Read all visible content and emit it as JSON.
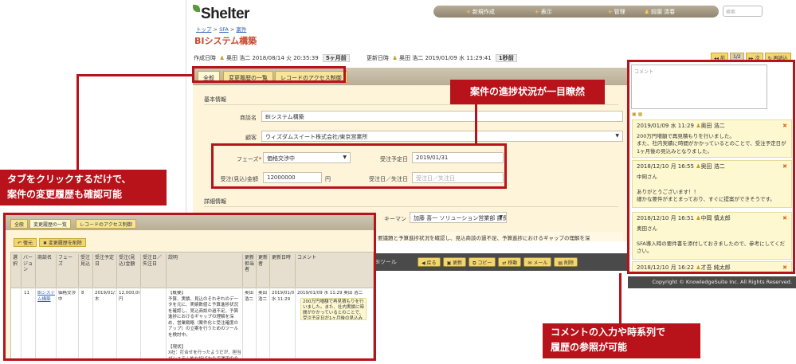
{
  "app": {
    "logo": "Shelter"
  },
  "nav": {
    "new": "新規作成",
    "view": "表示",
    "admin": "管理",
    "user": "前園 清春",
    "search_placeholder": "検索"
  },
  "breadcrumb": {
    "top": "トップ",
    "sfa": "SFA",
    "deal": "案件"
  },
  "page": {
    "title": "BIシステム構築"
  },
  "meta": {
    "created_label": "作成日時",
    "created_user": "奥田 浩二",
    "created_at": "2018/08/14 火 20:35:39",
    "created_ago": "5ヶ月前",
    "updated_label": "更新日時",
    "updated_user": "奥田 浩二",
    "updated_at": "2019/01/09 水 11:29:41",
    "updated_ago": "1秒前"
  },
  "pager": {
    "prev": "前",
    "current": "1/2",
    "next": "次",
    "reload": "再読込"
  },
  "tabs": {
    "all": "全般",
    "history": "変更履歴の一覧",
    "access": "レコードのアクセス制御"
  },
  "form": {
    "section_basic": "基本情報",
    "deal_name_label": "商談名",
    "deal_name": "BIシステム構築",
    "customer_label": "顧客",
    "customer": "ウィズダムスイート株式会社/東京営業所",
    "phase_label": "フェーズ",
    "phase": "価格交渉中",
    "expected_date_label": "受注予定日",
    "expected_date": "2019/01/31",
    "amount_label": "受注(見込)金額",
    "amount": "12000000",
    "amount_unit": "円",
    "order_date_label": "受注日／失注日",
    "order_date_placeholder": "受注日／失注日",
    "section_detail": "詳細情報",
    "keyman_label": "キーマン",
    "keyman": "加藤 喜一 ソリューション営業部 課長",
    "notes_partial_1": "要議題と予算進捗状況を確認し、見込商談の過不足、予算進捗におけるギャップの理解を深",
    "notes_partial_2": "立案を行うためのツールを検討中。",
    "notes_partial_3": "BIツール"
  },
  "actions": {
    "back": "戻る",
    "update": "更新",
    "copy": "コピー",
    "move": "移動",
    "mail": "メール",
    "delete": "削除"
  },
  "footer": {
    "copyright": "Copyright © KnowledgeSuite Inc. All Rights Reserved."
  },
  "comments": {
    "placeholder": "コメント",
    "items": [
      {
        "date": "2019/01/09 水 11:29",
        "user": "奥田 浩二",
        "body": "200万円増額で再見積もりを行いました。\nまた、社内実績に時間がかかっているとのことで、受注予定日が1ヶ月後の見込みとなりました。"
      },
      {
        "date": "2018/12/10 月 16:55",
        "user": "奥田 浩二",
        "body": "中岡さん\n\nありがとうございます！！\n細かな要件がまとまっており、すぐに提案ができそうです。"
      },
      {
        "date": "2018/12/10 月 16:51",
        "user": "中岡 慎太郎",
        "body": "奥田さん\n\nSFA導入時の要件書を添付しておきましたので、参考にしてください。"
      },
      {
        "date": "2018/12/10 月 16:22",
        "user": "才吾 純太郎",
        "body": ""
      }
    ]
  },
  "callouts": {
    "progress": "案件の進捗状況が一目瞭然",
    "tabs_line1": "タブをクリックするだけで、",
    "tabs_line2": "案件の変更履歴も確認可能",
    "comments_line1": "コメントの入力や時系列で",
    "comments_line2": "履歴の参照が可能"
  },
  "history": {
    "tabs": {
      "all": "全般",
      "history": "変更履歴の一覧",
      "access": "レコードのアクセス制御"
    },
    "restore": "復元",
    "delete_history": "変更履歴を削除",
    "headers": [
      "選択",
      "バージョン",
      "商談名",
      "フェーズ",
      "受注見込",
      "受注予定日",
      "受注(見込)金額",
      "受注日／失注日",
      "説明",
      "更新担当者",
      "更新者",
      "更新日時",
      "コメント"
    ],
    "row": {
      "version": "11",
      "deal": "BIシステム構築",
      "phase": "価格交渉中",
      "prob": "8",
      "date": "2019/01/31 木",
      "amount": "12,000,000 円",
      "desc": "【概要】\n予算、実績、見込のそれぞれのデータを元に、実績数値と予算進捗状況を確認し、見込商談の過不足、予算進捗におけるギャップの理解を深め、営業戦略（案件化と受注確度のアップ）の立案を行うためのツールを検討中。\n\n【現状】\nX社：打合せを行ったようだが、担当がシステム的な話ばかりで運用の会話ができていた。見送りとのこと。",
      "owner": "奥田 浩二",
      "updater": "奥田 浩二",
      "updated": "2019/01/09 水 11:29",
      "comment_head": "2019/01/09 水 11:29  奥田 浩二",
      "comment": "200万円増額で再見積もりを行いました。また、社内実績に時間がかかっているとのことで、受注予定日が1ヶ月後の見込みとなりました。"
    }
  }
}
